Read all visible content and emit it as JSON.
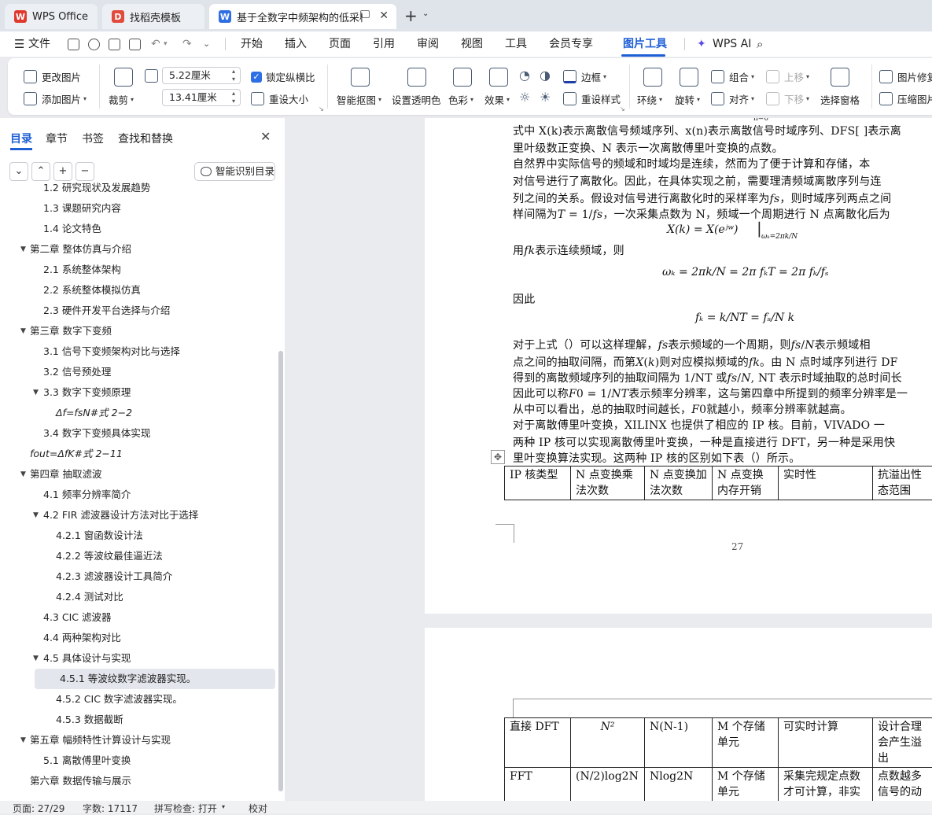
{
  "tabs": [
    {
      "label": "WPS Office",
      "icon": "wps-logo-icon"
    },
    {
      "label": "找稻壳模板",
      "icon": "docer-icon"
    },
    {
      "label": "基于全数字中频架构的低采样",
      "icon": "word-doc-icon"
    }
  ],
  "menu": {
    "file": "文件",
    "items": [
      "开始",
      "插入",
      "页面",
      "引用",
      "审阅",
      "视图",
      "工具",
      "会员专享",
      "图片工具"
    ],
    "wps_ai": "WPS AI"
  },
  "ribbon": {
    "change_picture": "更改图片",
    "add_picture": "添加图片",
    "crop": "裁剪",
    "width_value": "5.22厘米",
    "height_value": "13.41厘米",
    "lock_ratio": "锁定纵横比",
    "reset_size": "重设大小",
    "smart_cutout": "智能抠图",
    "set_transparent": "设置透明色",
    "color": "色彩",
    "effects": "效果",
    "border": "边框",
    "reset_style": "重设样式",
    "wrap": "环绕",
    "rotate": "旋转",
    "group": "组合",
    "align": "对齐",
    "move_up": "上移",
    "move_down": "下移",
    "selection_pane": "选择窗格",
    "image_repair": "图片修复",
    "compress": "压缩图片"
  },
  "panel": {
    "tabs": [
      "目录",
      "章节",
      "书签",
      "查找和替换"
    ],
    "smart_toc": "智能识别目录",
    "toc": [
      {
        "text": "1.2 研究现状及发展趋势",
        "indent": 1
      },
      {
        "text": "1.3 课题研究内容",
        "indent": 1
      },
      {
        "text": "1.4 论文特色",
        "indent": 1
      },
      {
        "text": "第二章  整体仿真与介绍",
        "indent": 0,
        "expanded": true
      },
      {
        "text": "2.1  系统整体架构",
        "indent": 1
      },
      {
        "text": "2.2  系统整体模拟仿真",
        "indent": 1
      },
      {
        "text": "2.3 硬件开发平台选择与介绍",
        "indent": 1
      },
      {
        "text": "第三章  数字下变频",
        "indent": 0,
        "expanded": true
      },
      {
        "text": "3.1 信号下变频架构对比与选择",
        "indent": 1
      },
      {
        "text": "3.2 信号预处理",
        "indent": 1
      },
      {
        "text": "3.3 数字下变频原理",
        "indent": 1,
        "expanded": true
      },
      {
        "text": "Δf=fsN#式 2−2",
        "indent": 2
      },
      {
        "text": "3.4 数字下变频具体实现",
        "indent": 1
      },
      {
        "text": "fout=ΔfK#式 2−11",
        "indent": -1
      },
      {
        "text": "第四章  抽取滤波",
        "indent": 0,
        "expanded": true
      },
      {
        "text": "4.1 频率分辨率简介",
        "indent": 1
      },
      {
        "text": "4.2 FIR 滤波器设计方法对比于选择",
        "indent": 1,
        "expanded": true
      },
      {
        "text": "4.2.1  窗函数设计法",
        "indent": 2
      },
      {
        "text": "4.2.2 等波纹最佳逼近法",
        "indent": 2
      },
      {
        "text": "4.2.3  滤波器设计工具简介",
        "indent": 2
      },
      {
        "text": "4.2.4 测试对比",
        "indent": 2
      },
      {
        "text": "4.3 CIC 滤波器",
        "indent": 1
      },
      {
        "text": "4.4 两种架构对比",
        "indent": 1
      },
      {
        "text": "4.5  具体设计与实现",
        "indent": 1,
        "expanded": true
      },
      {
        "text": "4.5.1 等波纹数字滤波器实现。",
        "indent": 2,
        "selected": true
      },
      {
        "text": "4.5.2 CIC 数字滤波器实现。",
        "indent": 2
      },
      {
        "text": "4.5.3 数据截断",
        "indent": 2
      },
      {
        "text": "第五章  幅频特性计算设计与实现",
        "indent": 0,
        "expanded": true
      },
      {
        "text": "5.1  离散傅里叶变换",
        "indent": 1
      },
      {
        "text": "第六章  数据传输与展示",
        "indent": 0
      }
    ]
  },
  "document": {
    "page1_lines": [
      "式中 X(k)表示离散信号频域序列、x(n)表示离散信号时域序列、DFS[ ]表示离",
      "里叶级数正变换、N 表示一次离散傅里叶变换的点数。",
      "    自然界中实际信号的频域和时域均是连续，然而为了便于计算和存储，本",
      "对信号进行了离散化。因此，在具体实现之前，需要理清频域离散序列与连",
      "列之间的关系。假设对信号进行离散化时的采样率为𝑓𝑠，则时域序列两点之间",
      "样间隔为𝑇 = 1/𝑓𝑠，一次采集点数为 N，频域一个周期进行 N 点离散化后为"
    ],
    "eq1": "X(k) = X(eʲʷ)",
    "eq1_sub": "ωₖ=2πk/N",
    "line_fk": "用𝑓𝑘表示连续频域，则",
    "eq2": "ωₖ = 2πk/N = 2π fₖT = 2π fₖ/fₛ",
    "line_yinci": "因此",
    "eq3": "fₖ = k/NT = fₛ/N k",
    "page1_lines2": [
      "    对于上式（）可以这样理解，𝑓𝑠表示频域的一个周期，则𝑓𝑠/𝑁表示频域相",
      "点之间的抽取间隔，而第𝑋(𝑘)则对应模拟频域的𝑓𝑘。由 N 点时域序列进行 DF",
      "得到的离散频域序列的抽取间隔为 1/NT 或𝑓𝑠/𝑁, NT 表示时域抽取的总时间长",
      "因此可以称𝐹0 = 1/𝑁𝑇表示频率分辨率，这与第四章中所提到的频率分辨率是一",
      "从中可以看出，总的抽取时间越长，𝐹0就越小，频率分辨率就越高。",
      "    对于离散傅里叶变换，XILINX 也提供了相应的 IP 核。目前，VIVADO 一",
      "两种 IP 核可以实现离散傅里叶变换，一种是直接进行 DFT，另一种是采用快",
      "里叶变换算法实现。这两种 IP 核的区别如下表（）所示。"
    ],
    "table_header": [
      "IP 核类型",
      "N 点变换乘法次数",
      "N 点变换加法次数",
      "N 点变换内存开销",
      "实时性",
      "抗溢出性态范围"
    ],
    "page_number": "27",
    "table2_rows": [
      [
        "直接 DFT",
        "N²",
        "N(N-1)",
        "M 个存储单元",
        "可实时计算",
        "设计合理会产生溢出"
      ],
      [
        "FFT",
        "(N/2)log2N",
        "Nlog2N",
        "M 个存储单元",
        "采集完规定点数才可计算，非实时。",
        "点数越多信号的动围越小。."
      ]
    ]
  },
  "status": {
    "page": "页面: 27/29",
    "words": "字数: 17117",
    "spell": "拼写检查: 打开",
    "proof": "校对"
  }
}
